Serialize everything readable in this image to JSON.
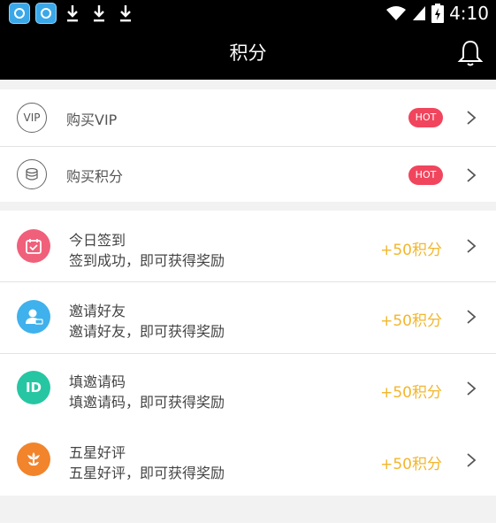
{
  "status_bar": {
    "time": "4:10"
  },
  "header": {
    "title": "积分"
  },
  "purchase_items": [
    {
      "icon_text": "VIP",
      "label": "购买VIP",
      "badge": "HOT"
    },
    {
      "icon_text": "",
      "label": "购买积分",
      "badge": "HOT"
    }
  ],
  "tasks": [
    {
      "icon": "calendar-icon",
      "color": "#f0607a",
      "title": "今日签到",
      "subtitle": "签到成功，即可获得奖励",
      "reward": "+50积分"
    },
    {
      "icon": "invite-friend-icon",
      "color": "#3fb1ec",
      "title": "邀请好友",
      "subtitle": "邀请好友，即可获得奖励",
      "reward": "+50积分"
    },
    {
      "icon": "id-icon",
      "color": "#26c6a3",
      "icon_text": "ID",
      "title": "填邀请码",
      "subtitle": "填邀请码，即可获得奖励",
      "reward": "+50积分"
    },
    {
      "icon": "flower-icon",
      "color": "#f2842b",
      "title": "五星好评",
      "subtitle": "五星好评，即可获得奖励",
      "reward": "+50积分"
    }
  ]
}
